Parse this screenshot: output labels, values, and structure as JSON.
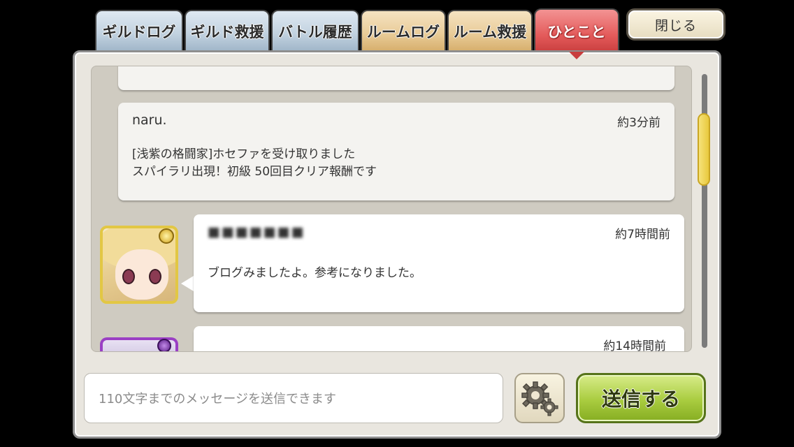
{
  "tabs": [
    {
      "label": "ギルドログ"
    },
    {
      "label": "ギルド救援"
    },
    {
      "label": "バトル履歴"
    },
    {
      "label": "ルームログ"
    },
    {
      "label": "ルーム救援"
    },
    {
      "label": "ひとこと"
    }
  ],
  "close_label": "閉じる",
  "messages": [
    {
      "name": "",
      "time": "",
      "text": ""
    },
    {
      "name": "naru.",
      "time": "約3分前",
      "text": "[浅紫の格闘家]ホセファを受け取りました\nスパイラリ出現！初級 50回目クリア報酬です"
    },
    {
      "name": "■■■■■■■",
      "time": "約7時間前",
      "text": "ブログみましたよ。参考になりました。"
    },
    {
      "name": "",
      "time": "約14時間前",
      "text": ""
    }
  ],
  "input": {
    "placeholder": "110文字までのメッセージを送信できます"
  },
  "send_label": "送信する",
  "icons": {
    "settings": "gear-icon",
    "avatar": "character-avatar"
  },
  "colors": {
    "active_tab": "#e35a5a",
    "send_button": "#a9cc3f",
    "avatar_border": "#e2c744"
  }
}
